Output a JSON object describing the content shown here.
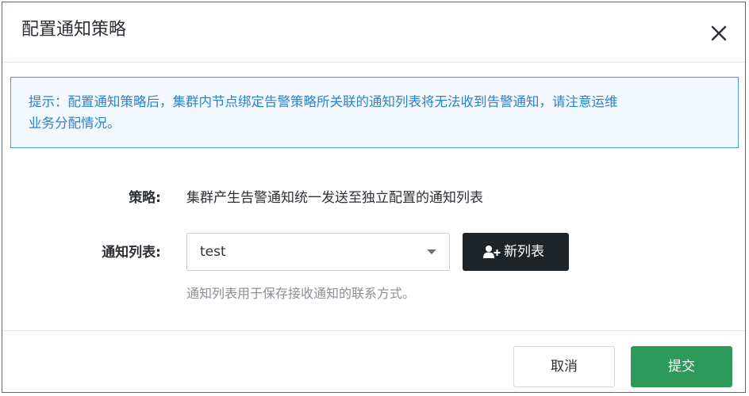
{
  "dialog": {
    "title": "配置通知策略",
    "close_icon": "close-icon"
  },
  "notice": {
    "text_line1": "提示：配置通知策略后，集群内节点绑定告警策略所关联的通知列表将无法收到告警通知，请注意运维",
    "text_line2": "业务分配情况。"
  },
  "form": {
    "strategy_label": "策略:",
    "strategy_value": "集群产生告警通知统一发送至独立配置的通知列表",
    "list_label": "通知列表:",
    "list_selected": "test",
    "new_list_label": "新列表",
    "new_list_icon": "add-user-icon",
    "help_text": "通知列表用于保存接收通知的联系方式。"
  },
  "footer": {
    "cancel_label": "取消",
    "submit_label": "提交"
  },
  "colors": {
    "notice_border": "#4e9bd6",
    "notice_text": "#2c83c7",
    "submit_bg": "#2e9a5a",
    "new_list_bg": "#1e2328"
  }
}
